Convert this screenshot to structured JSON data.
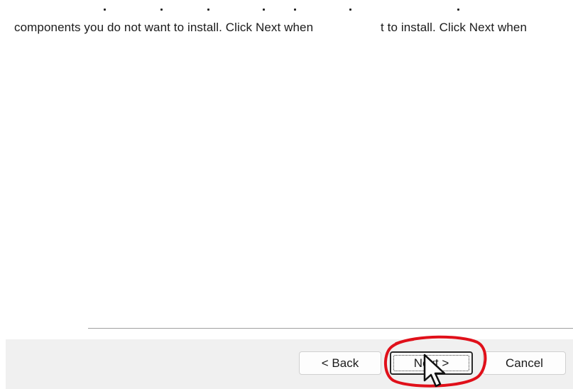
{
  "installer": {
    "description_fragment_1": "components you do not want to install. Click Next when",
    "description_fragment_2": "t to install. Click Next when"
  },
  "buttons": {
    "back_label": "< Back",
    "next_label": "Next >",
    "cancel_label": "Cancel"
  },
  "annotation": {
    "color": "#e0101a",
    "icon": "red-circle-highlight"
  },
  "cursor": {
    "icon": "arrow-pointer-icon"
  }
}
